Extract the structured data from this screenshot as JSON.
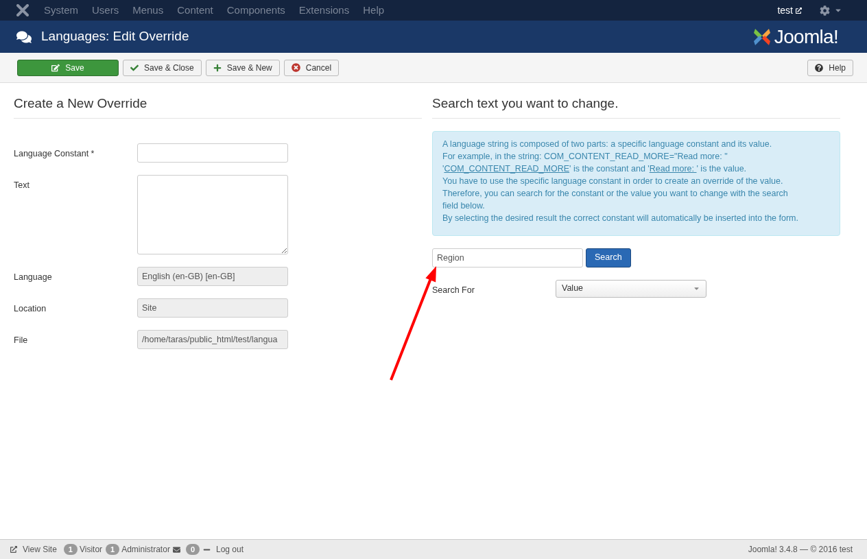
{
  "top_menu": {
    "items": [
      "System",
      "Users",
      "Menus",
      "Content",
      "Components",
      "Extensions",
      "Help"
    ],
    "user": "test"
  },
  "header": {
    "title": "Languages: Edit Override",
    "logo": "Joomla!"
  },
  "toolbar": {
    "buttons": [
      {
        "label": "Save",
        "kind": "primary"
      },
      {
        "label": "Save & Close",
        "kind": "check"
      },
      {
        "label": "Save & New",
        "kind": "plus"
      },
      {
        "label": "Cancel",
        "kind": "cancel"
      }
    ],
    "help": "Help"
  },
  "form": {
    "title": "Create a New Override",
    "fields": [
      {
        "label": "Language Constant *",
        "kind": "input",
        "disabled": false
      },
      {
        "label": "Text",
        "kind": "textarea",
        "disabled": false
      },
      {
        "label": "Language",
        "kind": "input",
        "value": "English (en-GB) [en-GB]",
        "disabled": true
      },
      {
        "label": "Location",
        "kind": "input",
        "value": "Site",
        "disabled": true
      },
      {
        "label": "File",
        "kind": "input",
        "value": "/home/taras/public_html/test/langua",
        "disabled": true
      }
    ]
  },
  "search": {
    "title": "Search text you want to change.",
    "info": [
      [
        {
          "kind": "text",
          "text": "A language string is composed of two parts: a specific language constant and its value."
        }
      ],
      [
        {
          "kind": "text",
          "text": "For example, in the string: COM_CONTENT_READ_MORE=\"Read more: \""
        }
      ],
      [
        {
          "kind": "text",
          "text": "'"
        },
        {
          "kind": "link",
          "text": "COM_CONTENT_READ_MORE"
        },
        {
          "kind": "text",
          "text": "' is the constant and '"
        },
        {
          "kind": "link",
          "text": "Read more: "
        },
        {
          "kind": "text",
          "text": "' is the value."
        }
      ],
      [
        {
          "kind": "text",
          "text": "You have to use the specific language constant in order to create an override of the value."
        }
      ],
      [
        {
          "kind": "text",
          "text": "Therefore, you can search for the constant or the value you want to change with the search field below."
        }
      ],
      [
        {
          "kind": "text",
          "text": "By selecting the desired result the correct constant will automatically be inserted into the form."
        }
      ]
    ],
    "query": "Region",
    "button": "Search",
    "search_for_label": "Search For",
    "search_for_value": "Value"
  },
  "annotation": {
    "kind": "arrow"
  },
  "footer": {
    "view_site": "View Site",
    "visitors": "1",
    "visitor_label": "Visitor",
    "admins": "1",
    "admin_label": "Administrator",
    "messages": "0",
    "logout": "Log out",
    "copyright": "Joomla! 3.4.8 — © 2016 test"
  }
}
